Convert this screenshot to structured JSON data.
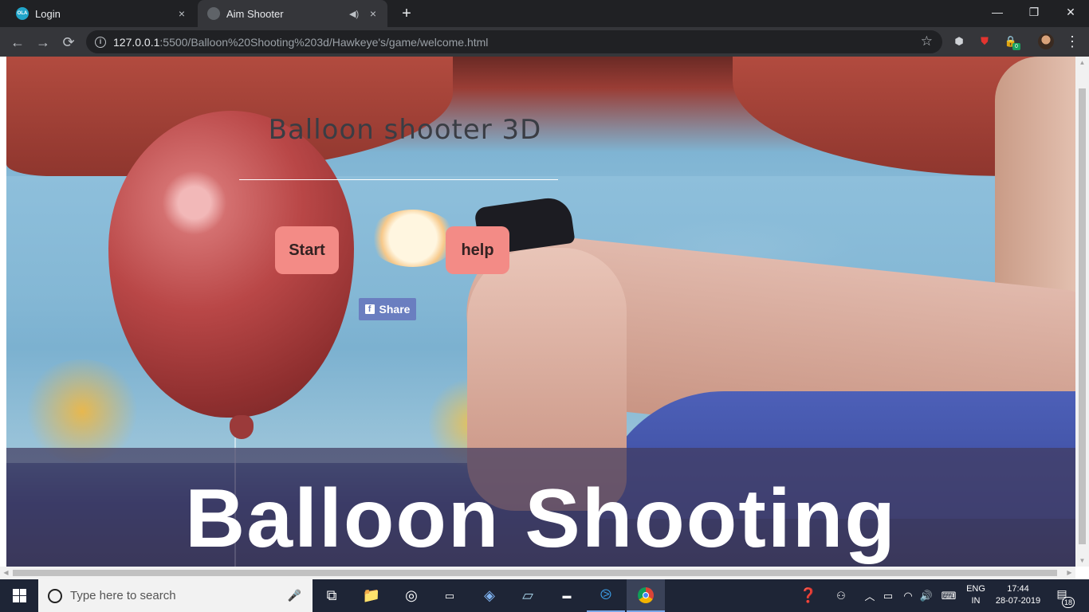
{
  "browser": {
    "tabs": [
      {
        "title": "Login",
        "favicon": "ola-icon",
        "close": "×"
      },
      {
        "title": "Aim Shooter",
        "favicon": "globe-icon",
        "close": "×",
        "audio": "speaker-icon"
      }
    ],
    "new_tab": "+",
    "window_controls": {
      "minimize": "—",
      "restore": "❐",
      "close": "✕"
    },
    "nav": {
      "back": "←",
      "forward": "→",
      "reload": "⟳"
    },
    "url_host": "127.0.0.1",
    "url_path": ":5500/Balloon%20Shooting%203d/Hawkeye's/game/welcome.html",
    "bookmark_star": "☆",
    "extensions": [
      "cube-icon",
      "shield-icon",
      "lock-extension-icon"
    ],
    "extension_badge": "0",
    "menu": "⋮"
  },
  "page": {
    "game_title": "Balloon shooter 3D",
    "start_button": "Start",
    "help_button": "help",
    "share_button": "Share",
    "share_icon": "f",
    "banner_text": "Balloon Shooting"
  },
  "taskbar": {
    "search_placeholder": "Type here to search",
    "mic": "🎤",
    "apps": [
      "task-view-icon",
      "file-explorer-icon",
      "media-icon",
      "terminal-icon",
      "settings-diamond-icon",
      "notepad-icon",
      "mysql-icon",
      "vscode-icon",
      "chrome-icon"
    ],
    "language_line1": "ENG",
    "language_line2": "IN",
    "time": "17:44",
    "date": "28-07-2019",
    "notification_count": "18"
  }
}
